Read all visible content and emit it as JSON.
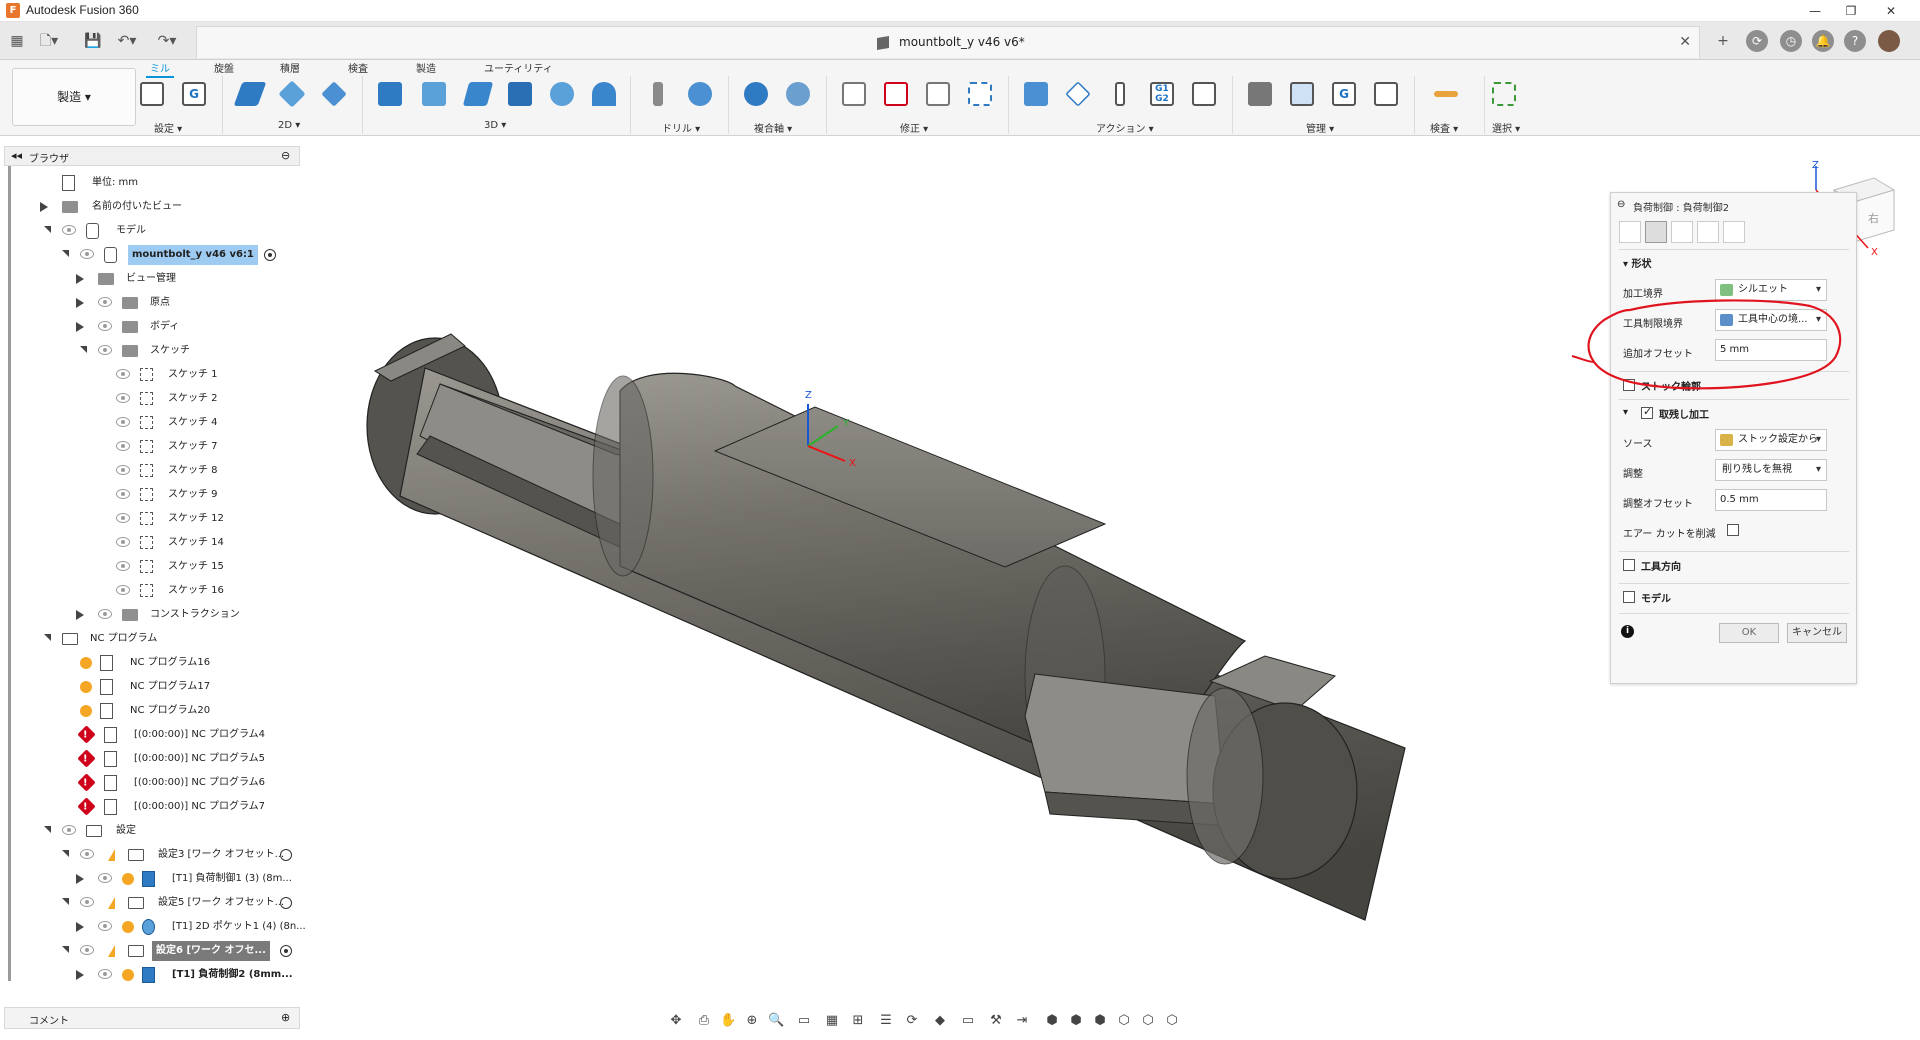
{
  "app": {
    "title": "Autodesk Fusion 360"
  },
  "document": {
    "tab_title": "mountbolt_y v46 v6*"
  },
  "toolbar": {
    "workspace": "製造",
    "tabs": [
      "ミル",
      "旋盤",
      "積層",
      "検査",
      "製造",
      "ユーティリティ"
    ],
    "groups": [
      "設定",
      "2D",
      "3D",
      "ドリル",
      "複合軸",
      "修正",
      "アクション",
      "管理",
      "検査",
      "選択"
    ]
  },
  "browser": {
    "title": "ブラウザ",
    "units": "単位: mm",
    "named_views": "名前の付いたビュー",
    "model": "モデル",
    "component": "mountbolt_y v46 v6:1",
    "view_mgmt": "ビュー管理",
    "origin": "原点",
    "bodies": "ボディ",
    "sketches": "スケッチ",
    "sketch_items": [
      "スケッチ 1",
      "スケッチ 2",
      "スケッチ 4",
      "スケッチ 7",
      "スケッチ 8",
      "スケッチ 9",
      "スケッチ 12",
      "スケッチ 14",
      "スケッチ 15",
      "スケッチ 16"
    ],
    "construction": "コンストラクション",
    "nc_programs": "NC プログラム",
    "nc_ok": [
      "NC プログラム16",
      "NC プログラム17",
      "NC プログラム20"
    ],
    "nc_err": [
      "[(0:00:00)] NC プログラム4",
      "[(0:00:00)] NC プログラム5",
      "[(0:00:00)] NC プログラム6",
      "[(0:00:00)] NC プログラム7"
    ],
    "setups": "設定",
    "setup3": "設定3 [ワーク オフセット...",
    "op3": "[T1] 負荷制御1 (3) (8m...",
    "setup5": "設定5 [ワーク オフセット...",
    "op5": "[T1] 2D ポケット1 (4) (8n...",
    "setup6": "設定6 [ワーク オフセ...",
    "op6": "[T1] 負荷制御2 (8mm..."
  },
  "comments": {
    "label": "コメント"
  },
  "panel": {
    "title": "負荷制御 : 負荷制御2",
    "section_shape": "形状",
    "machining_boundary_label": "加工境界",
    "machining_boundary_value": "シルエット",
    "tool_containment_label": "工具制限境界",
    "tool_containment_value": "工具中心の境...",
    "additional_offset_label": "追加オフセット",
    "additional_offset_value": "5 mm",
    "section_stock": "ストック輪郭",
    "section_rest": "取残し加工",
    "source_label": "ソース",
    "source_value": "ストック設定から",
    "adjust_label": "調整",
    "adjust_value": "削り残しを無視",
    "adjust_offset_label": "調整オフセット",
    "adjust_offset_value": "0.5 mm",
    "air_cut_label": "エアー カットを削減",
    "section_tool_orientation": "工具方向",
    "section_model": "モデル",
    "ok": "OK",
    "cancel": "キャンセル",
    "rest_checked": true
  },
  "viewcube": {
    "face": "右",
    "axis_z": "Z",
    "axis_x": "X"
  },
  "triad": {
    "z": "Z",
    "y": "Y",
    "x": "X"
  },
  "colors": {
    "accent": "#0696d7",
    "annotation": "#e0141e",
    "part": "#6f6d66"
  }
}
